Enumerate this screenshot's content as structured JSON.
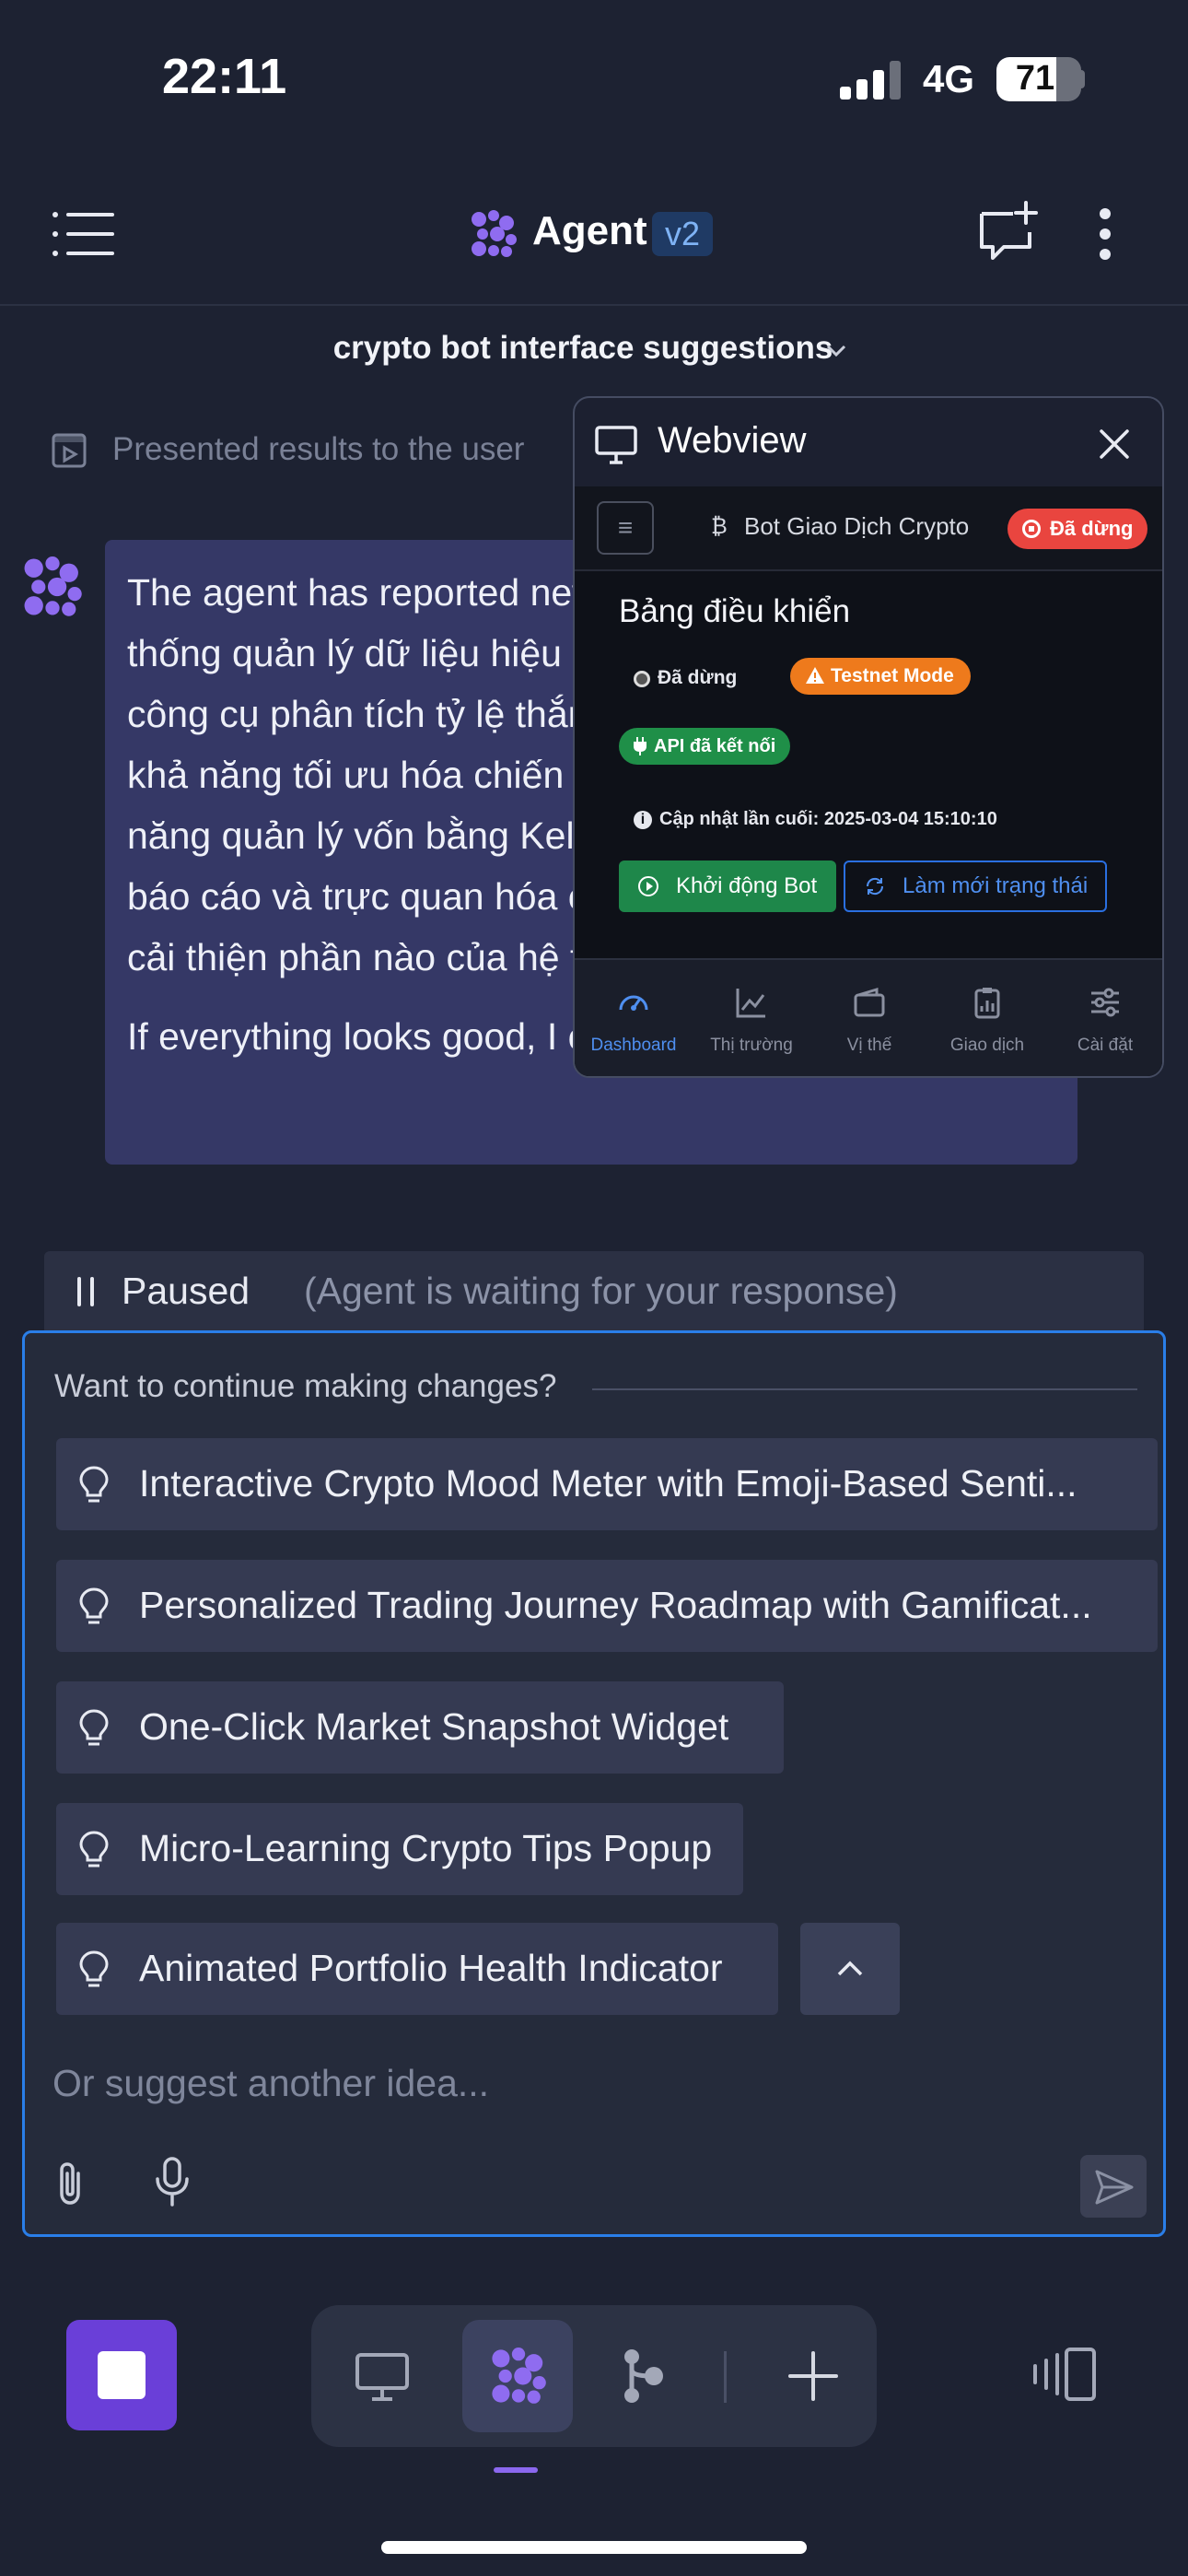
{
  "status_bar": {
    "time": "22:11",
    "network": "4G",
    "battery": "71",
    "battery_level": 0.71
  },
  "header": {
    "title": "Agent",
    "version": "v2"
  },
  "conversation": {
    "title": "crypto bot interface suggestions"
  },
  "presented": {
    "text": "Presented results to the user"
  },
  "message": {
    "paragraph1": "The agent has reported new progress: Triển khai hệ thống quản lý dữ liệu hiệu suất giao dịch ✅ Xây dựng công cụ phân tích tỷ lệ thắng/thua và ROI ✅ Phát triển khả năng tối ưu hóa chiến lược tự động ✅ Thêm tính năng quản lý vốn bằng Kelly Criterion ✅ Tạo giao diện báo cáo và trực quan hóa chi tiết Bạn muốn tôi tiếp tục cải thiện phần nào của hệ thống giao dịch?",
    "paragraph2": "If everything looks good, I can start testing the feature"
  },
  "webview": {
    "title": "Webview",
    "app_title": "Bot Giao Dịch Crypto",
    "stopped_badge": "Đã dừng",
    "dashboard_title": "Bảng điều khiển",
    "status_label": "Đã dừng",
    "testnet_label": "Testnet Mode",
    "api_label": "API đã kết nối",
    "last_updated": "Cập nhật lần cuối: 2025-03-04 15:10:10",
    "start_button": "Khởi động Bot",
    "refresh_button": "Làm mới trạng thái",
    "nav": [
      "Dashboard",
      "Thị trường",
      "Vị thế",
      "Giao dịch",
      "Cài đặt"
    ],
    "colors": {
      "danger": "#e9453f",
      "warning": "#ee7a1c",
      "success": "#1f8f48",
      "primary": "#2a6fe0"
    }
  },
  "paused": {
    "label": "Paused",
    "note": "(Agent is waiting for your response)"
  },
  "suggestions": {
    "prompt": "Want to continue making changes?",
    "items": [
      "Interactive Crypto Mood Meter with Emoji-Based Senti...",
      "Personalized Trading Journey Roadmap with Gamificat...",
      "One-Click Market Snapshot Widget",
      "Micro-Learning Crypto Tips Popup",
      "Animated Portfolio Health Indicator"
    ],
    "input_placeholder": "Or suggest another idea..."
  },
  "icons": {
    "header": [
      "menu-icon",
      "agent-logo-icon",
      "new-chat-icon",
      "more-vertical-icon"
    ],
    "dock": [
      "monitor-icon",
      "agent-logo-icon",
      "branch-icon",
      "plus-icon"
    ],
    "suggestion": "lightbulb-icon"
  },
  "theme": {
    "accent": "#6a3fd8",
    "focus": "#2a7ee8",
    "background": "#1d2232"
  }
}
